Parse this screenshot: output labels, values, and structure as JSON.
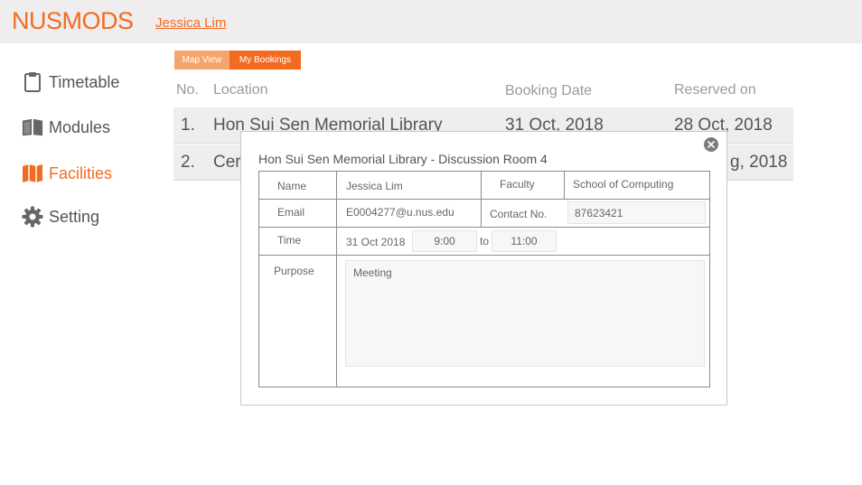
{
  "header": {
    "logo": "NUSMODS",
    "user": "Jessica Lim"
  },
  "sidebar": {
    "items": [
      {
        "label": "Timetable",
        "icon": "clipboard-icon"
      },
      {
        "label": "Modules",
        "icon": "book-icon"
      },
      {
        "label": "Facilities",
        "icon": "map-icon",
        "active": true
      },
      {
        "label": "Setting",
        "icon": "gear-icon"
      }
    ]
  },
  "tabs": [
    {
      "label": "Map View"
    },
    {
      "label": "My Bookings",
      "active": true
    }
  ],
  "table": {
    "headers": [
      "No.",
      "Location",
      "Booking Date",
      "Reserved on"
    ],
    "rows": [
      {
        "no": "1.",
        "location": "Hon Sui Sen Memorial Library",
        "booking_date": "31 Oct, 2018",
        "reserved_on": "28 Oct, 2018"
      },
      {
        "no": "2.",
        "location": "Cer",
        "booking_date": "",
        "reserved_on": "g, 2018"
      }
    ]
  },
  "modal": {
    "title": "Hon Sui Sen Memorial Library - Discussion Room 4",
    "fields": {
      "name_label": "Name",
      "name_value": "Jessica Lim",
      "faculty_label": "Faculty",
      "faculty_value": "School of Computing",
      "email_label": "Email",
      "email_value": "E0004277@u.nus.edu",
      "contact_label": "Contact No.",
      "contact_value": "87623421",
      "time_label": "Time",
      "date_value": "31 Oct 2018",
      "start_time": "9:00",
      "to_label": "to",
      "end_time": "11:00",
      "purpose_label": "Purpose",
      "purpose_value": "Meeting"
    }
  },
  "colors": {
    "accent": "#f36b21",
    "accent_light": "#f4a56d",
    "header_bg": "#efeded"
  }
}
